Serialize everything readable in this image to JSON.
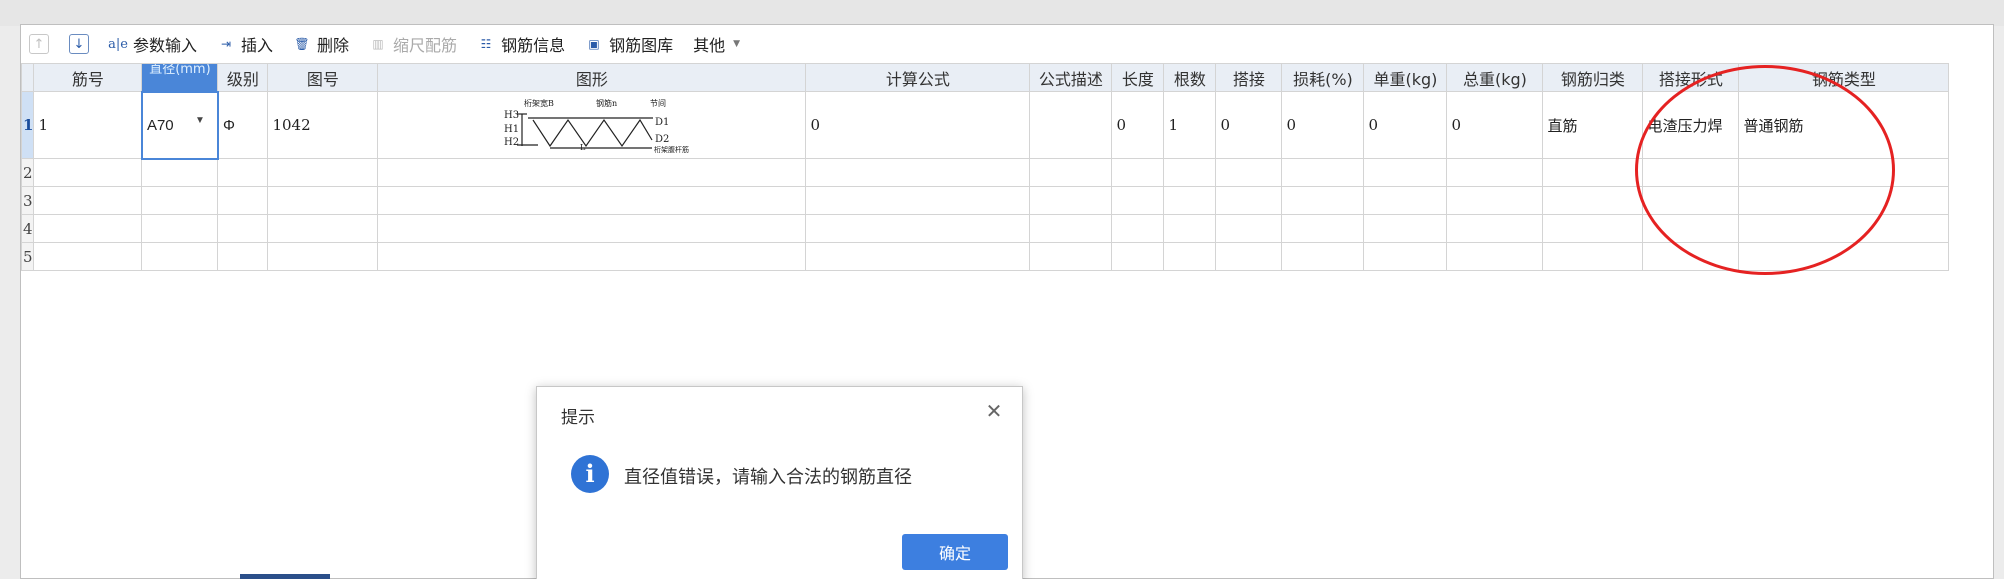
{
  "toolbar": {
    "up_icon": "arrow-up-icon",
    "down_icon": "arrow-down-icon",
    "param_input": "参数输入",
    "insert": "插入",
    "delete": "删除",
    "scale_rebar": "缩尺配筋",
    "rebar_info": "钢筋信息",
    "rebar_library": "钢筋图库",
    "other": "其他"
  },
  "table": {
    "headers": {
      "bar_no": "筋号",
      "diameter": "直径(mm)",
      "grade": "级别",
      "shape_no": "图号",
      "shape": "图形",
      "formula": "计算公式",
      "formula_desc": "公式描述",
      "length": "长度",
      "count": "根数",
      "lap": "搭接",
      "loss": "损耗(%)",
      "unit_weight": "单重(kg)",
      "total_weight": "总重(kg)",
      "rebar_category": "钢筋归类",
      "lap_type": "搭接形式",
      "rebar_type": "钢筋类型"
    },
    "rows": [
      {
        "num": "1",
        "bar_no": "1",
        "diameter": "A70",
        "grade": "Φ",
        "shape_no": "1042",
        "shape_labels": {
          "h3": "H3",
          "h1": "H1",
          "h2": "H2",
          "b_label": "桁架宽B",
          "n_label": "钢筋n",
          "pitch": "节间",
          "d1": "D1",
          "d2": "D2",
          "l": "L",
          "bottom": "桁架腹杆筋"
        },
        "formula": "0",
        "formula_desc": "",
        "length": "0",
        "count": "1",
        "lap": "0",
        "loss": "0",
        "unit_weight": "0",
        "total_weight": "0",
        "rebar_category": "直筋",
        "lap_type": "电渣压力焊",
        "rebar_type": "普通钢筋"
      },
      {
        "num": "2"
      },
      {
        "num": "3"
      },
      {
        "num": "4"
      },
      {
        "num": "5"
      }
    ]
  },
  "dialog": {
    "title": "提示",
    "message": "直径值错误，请输入合法的钢筋直径",
    "ok_label": "确定",
    "info_icon": "i"
  },
  "colors": {
    "accent": "#3d7fe0",
    "annotation": "#e52222",
    "header_selected": "#4a86d8"
  }
}
